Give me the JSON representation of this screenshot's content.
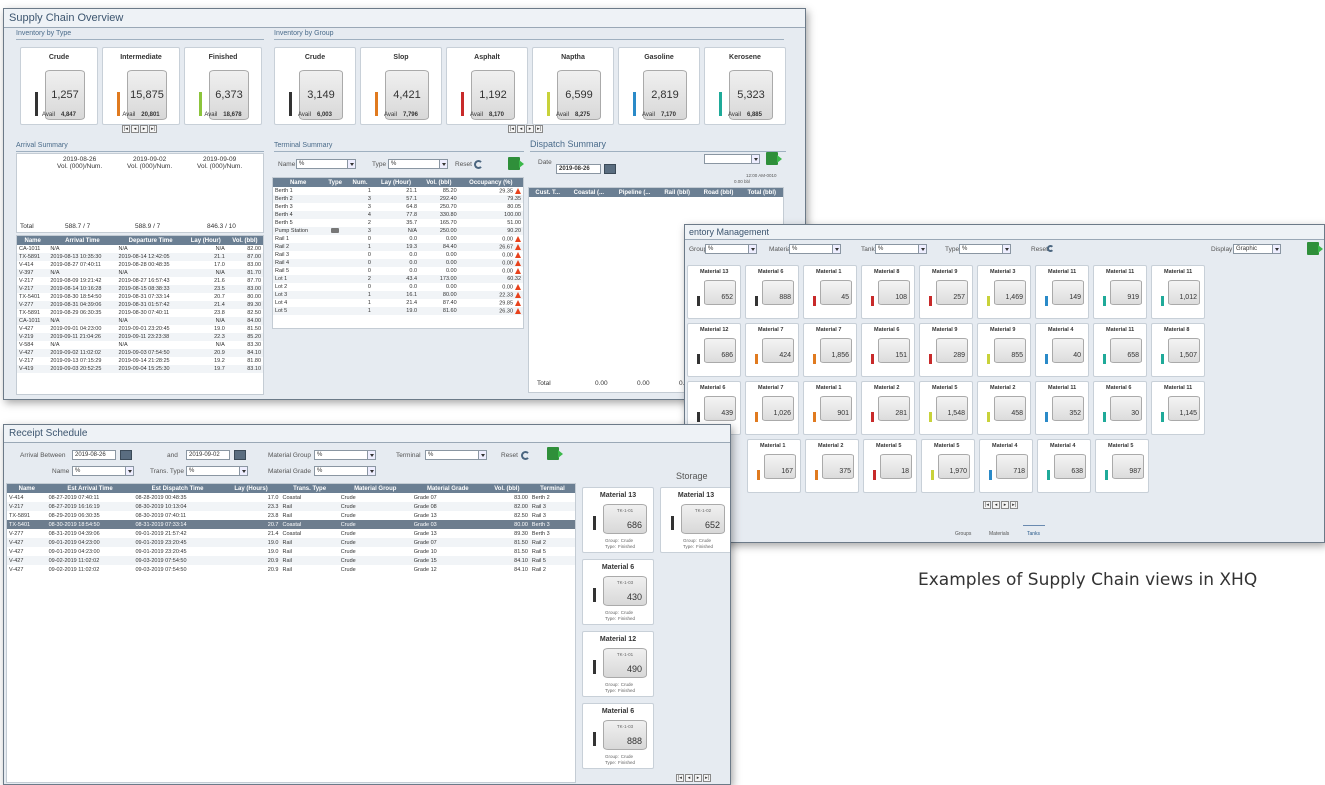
{
  "overview": {
    "title": "Supply Chain Overview",
    "inv_type_title": "Inventory by Type",
    "inv_group_title": "Inventory by Group",
    "type_cards": [
      {
        "name": "Crude",
        "value": "1,257",
        "avail": "4,847",
        "color": "#333333"
      },
      {
        "name": "Intermediate",
        "value": "15,875",
        "avail": "20,801",
        "color": "#e07a1f"
      },
      {
        "name": "Finished",
        "value": "6,373",
        "avail": "18,678",
        "color": "#8cc43c"
      }
    ],
    "group_cards": [
      {
        "name": "Crude",
        "value": "3,149",
        "avail": "6,003",
        "color": "#333333"
      },
      {
        "name": "Slop",
        "value": "4,421",
        "avail": "7,796",
        "color": "#e07a1f"
      },
      {
        "name": "Asphalt",
        "value": "1,192",
        "avail": "8,170",
        "color": "#c82a2a"
      },
      {
        "name": "Naptha",
        "value": "6,599",
        "avail": "8,275",
        "color": "#c8d23a"
      },
      {
        "name": "Gasoline",
        "value": "2,819",
        "avail": "7,170",
        "color": "#2a8ac8"
      },
      {
        "name": "Kerosene",
        "value": "5,323",
        "avail": "6,885",
        "color": "#1faa99"
      }
    ],
    "avail_label": "Avail",
    "arrival_title": "Arrival Summary",
    "arrival_dates": [
      "2019-08-26",
      "2019-09-02",
      "2019-09-09"
    ],
    "arrival_vol": [
      "Vol. (000)/Num.",
      "Vol. (000)/Num.",
      "Vol. (000)/Num."
    ],
    "arrival_totals": {
      "label": "Total",
      "v1": "588.7 / 7",
      "v2": "588.9 / 7",
      "v3": "846.3 / 10"
    },
    "arrival_headers": [
      "Name",
      "Arrival Time",
      "Departure Time",
      "Lay (Hour)",
      "Vol. (bbl)"
    ],
    "arrival_rows": [
      [
        "CA-1011",
        "N/A",
        "N/A",
        "N/A",
        "82.00"
      ],
      [
        "TX-5891",
        "2019-08-13 10:35:30",
        "2019-08-14 12:42:05",
        "21.1",
        "87.00"
      ],
      [
        "V-414",
        "2019-08-27 07:40:11",
        "2019-08-28 00:48:35",
        "17.0",
        "83.00"
      ],
      [
        "V-397",
        "N/A",
        "N/A",
        "N/A",
        "81.70"
      ],
      [
        "V-217",
        "2019-08-09 19:21:42",
        "2019-08-27 16:57:43",
        "21.6",
        "87.70"
      ],
      [
        "V-217",
        "2019-08-14 10:16:28",
        "2019-08-15 08:38:33",
        "23.5",
        "83.00"
      ],
      [
        "TX-5401",
        "2019-08-30 18:54:50",
        "2019-08-31 07:33:14",
        "20.7",
        "80.00"
      ],
      [
        "V-277",
        "2019-08-31 04:39:06",
        "2019-08-31 01:57:42",
        "21.4",
        "89.30"
      ],
      [
        "TX-5891",
        "2019-08-29 06:30:35",
        "2019-08-30 07:40:11",
        "23.8",
        "82.50"
      ],
      [
        "CA-1011",
        "N/A",
        "N/A",
        "N/A",
        "84.00"
      ],
      [
        "V-427",
        "2019-09-01 04:23:00",
        "2019-09-01 23:20:45",
        "19.0",
        "81.50"
      ],
      [
        "V-219",
        "2019-09-11 21:04:26",
        "2019-09-11 23:23:38",
        "22.3",
        "85.20"
      ],
      [
        "V-584",
        "N/A",
        "N/A",
        "N/A",
        "83.30"
      ],
      [
        "V-427",
        "2019-09-02 11:02:02",
        "2019-09-03 07:54:50",
        "20.9",
        "84.10"
      ],
      [
        "V-217",
        "2019-09-13 07:15:29",
        "2019-09-14 21:28:25",
        "19.2",
        "81.80"
      ],
      [
        "V-419",
        "2019-09-03 20:52:25",
        "2019-09-04 15:25:30",
        "19.7",
        "83.10"
      ]
    ],
    "terminal_title": "Terminal Summary",
    "terminal_name_label": "Name",
    "terminal_type_label": "Type",
    "terminal_reset": "Reset",
    "filter_all": "%",
    "terminal_headers": [
      "Name",
      "Type",
      "Num.",
      "Lay (Hour)",
      "Vol. (bbl)",
      "Occupancy (%)"
    ],
    "terminal_rows": [
      [
        "Berth 1",
        "",
        "1",
        "21.1",
        "85.20",
        "29.35",
        true
      ],
      [
        "Berth 2",
        "",
        "3",
        "57.1",
        "292.40",
        "79.35",
        false
      ],
      [
        "Berth 3",
        "",
        "3",
        "64.8",
        "250.70",
        "80.05",
        false
      ],
      [
        "Berth 4",
        "",
        "4",
        "77.8",
        "330.80",
        "100.00",
        false
      ],
      [
        "Berth 5",
        "",
        "2",
        "35.7",
        "165.70",
        "51.00",
        false
      ],
      [
        "Pump Station",
        "",
        "3",
        "N/A",
        "250.00",
        "90.20",
        false
      ],
      [
        "Rail 1",
        "",
        "0",
        "0.0",
        "0.00",
        "0.00",
        true
      ],
      [
        "Rail 2",
        "",
        "1",
        "19.3",
        "84.40",
        "26.67",
        true
      ],
      [
        "Rail 3",
        "",
        "0",
        "0.0",
        "0.00",
        "0.00",
        true
      ],
      [
        "Rail 4",
        "",
        "0",
        "0.0",
        "0.00",
        "0.00",
        true
      ],
      [
        "Rail 5",
        "",
        "0",
        "0.0",
        "0.00",
        "0.00",
        true
      ],
      [
        "Lot 1",
        "",
        "2",
        "43.4",
        "173.00",
        "60.32",
        false
      ],
      [
        "Lot 2",
        "",
        "0",
        "0.0",
        "0.00",
        "0.00",
        true
      ],
      [
        "Lot 3",
        "",
        "1",
        "16.1",
        "80.00",
        "22.33",
        true
      ],
      [
        "Lot 4",
        "",
        "1",
        "21.4",
        "87.40",
        "29.85",
        true
      ],
      [
        "Lot 5",
        "",
        "1",
        "19.0",
        "81.60",
        "26.30",
        true
      ]
    ],
    "dispatch_title": "Dispatch Summary",
    "dispatch_date_label": "Date",
    "dispatch_date": "2019-08-26",
    "dispatch_headers": [
      "Cust. T...",
      "Coastal (...",
      "Pipeline (...",
      "Rail (bbl)",
      "Road (bbl)",
      "Total (bbl)"
    ],
    "dispatch_total_label": "Total",
    "dispatch_totals": [
      "0.00",
      "0.00",
      "0.00"
    ],
    "dispatch_small": [
      "0.00 bbl",
      "12:00 AM-0010"
    ]
  },
  "inventory": {
    "title": "entory Management",
    "filters": [
      "Group",
      "Material",
      "Tank",
      "Type"
    ],
    "reset": "Reset",
    "display_label": "Display",
    "display_value": "Graphic",
    "tabs": [
      "Groups",
      "Materials",
      "Tanks"
    ],
    "rows": [
      [
        [
          "Material 13",
          "652",
          "#333333"
        ],
        [
          "Material 6",
          "888",
          "#333333"
        ],
        [
          "Material 1",
          "45",
          "#c82a2a"
        ],
        [
          "Material 8",
          "108",
          "#c82a2a"
        ],
        [
          "Material 9",
          "257",
          "#c82a2a"
        ],
        [
          "Material 3",
          "1,469",
          "#c8d23a"
        ],
        [
          "Material 11",
          "149",
          "#2a8ac8"
        ],
        [
          "Material 11",
          "919",
          "#1faa99"
        ],
        [
          "Material 11",
          "1,012",
          "#1faa99"
        ]
      ],
      [
        [
          "Material 12",
          "686",
          "#333333"
        ],
        [
          "Material 7",
          "424",
          "#e07a1f"
        ],
        [
          "Material 7",
          "1,856",
          "#e07a1f"
        ],
        [
          "Material 6",
          "151",
          "#c82a2a"
        ],
        [
          "Material 9",
          "289",
          "#c82a2a"
        ],
        [
          "Material 9",
          "855",
          "#c8d23a"
        ],
        [
          "Material 4",
          "40",
          "#2a8ac8"
        ],
        [
          "Material 11",
          "658",
          "#1faa99"
        ],
        [
          "Material 8",
          "1,507",
          "#1faa99"
        ]
      ],
      [
        [
          "Material 6",
          "439",
          "#333333"
        ],
        [
          "Material 7",
          "1,026",
          "#e07a1f"
        ],
        [
          "Material 1",
          "901",
          "#e07a1f"
        ],
        [
          "Material 2",
          "281",
          "#c82a2a"
        ],
        [
          "Material 5",
          "1,548",
          "#c8d23a"
        ],
        [
          "Material 2",
          "458",
          "#c8d23a"
        ],
        [
          "Material 11",
          "352",
          "#2a8ac8"
        ],
        [
          "Material 6",
          "30",
          "#1faa99"
        ],
        [
          "Material 11",
          "1,145",
          "#1faa99"
        ]
      ],
      [
        [
          "Material 1",
          "167",
          "#e07a1f"
        ],
        [
          "Material 2",
          "375",
          "#e07a1f"
        ],
        [
          "Material 5",
          "18",
          "#c82a2a"
        ],
        [
          "Material 5",
          "1,970",
          "#c8d23a"
        ],
        [
          "Material 4",
          "718",
          "#2a8ac8"
        ],
        [
          "Material 4",
          "638",
          "#1faa99"
        ],
        [
          "Material 5",
          "987",
          "#1faa99"
        ]
      ]
    ]
  },
  "receipt": {
    "title": "Receipt Schedule",
    "arrival_between": "Arrival Between",
    "date_from": "2019-08-26",
    "and_label": "and",
    "date_to": "2019-09-02",
    "material_group": "Material Group",
    "terminal": "Terminal",
    "reset": "Reset",
    "name_label": "Name",
    "trans_type": "Trans. Type",
    "material_grade": "Material Grade",
    "filter_all": "%",
    "headers": [
      "Name",
      "Est Arrival Time",
      "Est Dispatch Time",
      "Lay (Hours)",
      "Trans. Type",
      "Material Group",
      "Material Grade",
      "Vol. (bbl)",
      "Terminal"
    ],
    "rows": [
      [
        "V-414",
        "08-27-2019 07:40:11",
        "08-28-2019 00:48:35",
        "17.0",
        "Coastal",
        "Crude",
        "Grade 07",
        "83.00",
        "Berth 2"
      ],
      [
        "V-217",
        "08-27-2019 16:16:19",
        "08-30-2019 10:13:04",
        "23.3",
        "Rail",
        "Crude",
        "Grade 08",
        "82.00",
        "Rail 3"
      ],
      [
        "TX-5891",
        "08-29-2019 06:30:35",
        "08-30-2019 07:40:11",
        "23.8",
        "Rail",
        "Crude",
        "Grade 13",
        "82.50",
        "Rail 3"
      ],
      [
        "TX-5401",
        "08-30-2019 18:54:50",
        "08-31-2019 07:33:14",
        "20.7",
        "Coastal",
        "Crude",
        "Grade 03",
        "80.00",
        "Berth 3"
      ],
      [
        "V-277",
        "08-31-2019 04:39:06",
        "09-01-2019 21:57:42",
        "21.4",
        "Coastal",
        "Crude",
        "Grade 13",
        "89.30",
        "Berth 3"
      ],
      [
        "V-427",
        "09-01-2019 04:23:00",
        "09-01-2019 23:20:45",
        "19.0",
        "Rail",
        "Crude",
        "Grade 07",
        "81.50",
        "Rail 2"
      ],
      [
        "V-427",
        "09-01-2019 04:23:00",
        "09-01-2019 23:20:45",
        "19.0",
        "Rail",
        "Crude",
        "Grade 10",
        "81.50",
        "Rail 5"
      ],
      [
        "V-427",
        "09-02-2019 11:02:02",
        "09-03-2019 07:54:50",
        "20.9",
        "Rail",
        "Crude",
        "Grade 15",
        "84.10",
        "Rail 5"
      ],
      [
        "V-427",
        "09-02-2019 11:02:02",
        "09-03-2019 07:54:50",
        "20.9",
        "Rail",
        "Crude",
        "Grade 12",
        "84.10",
        "Rail 2"
      ]
    ],
    "selected_row": 3,
    "storage_title": "Storage",
    "storage_cards": [
      {
        "name": "Material 13",
        "tank": "TK-1-01",
        "value": "686",
        "group": "Crude",
        "type": "Finished",
        "color": "#333333"
      },
      {
        "name": "Material 13",
        "tank": "TK-1-02",
        "value": "652",
        "group": "Crude",
        "type": "Finished",
        "color": "#333333"
      },
      {
        "name": "Material 6",
        "tank": "TK-1-03",
        "value": "430",
        "group": "Crude",
        "type": "Finished",
        "color": "#333333"
      },
      {
        "name": "Material 12",
        "tank": "TK-1-01",
        "value": "490",
        "group": "Crude",
        "type": "Finished",
        "color": "#333333"
      },
      {
        "name": "Material 6",
        "tank": "TK-1-03",
        "value": "888",
        "group": "Crude",
        "type": "Finished",
        "color": "#333333"
      }
    ],
    "group_label": "Group:",
    "type_label": "Type:"
  },
  "caption": "Examples of Supply Chain views in XHQ"
}
